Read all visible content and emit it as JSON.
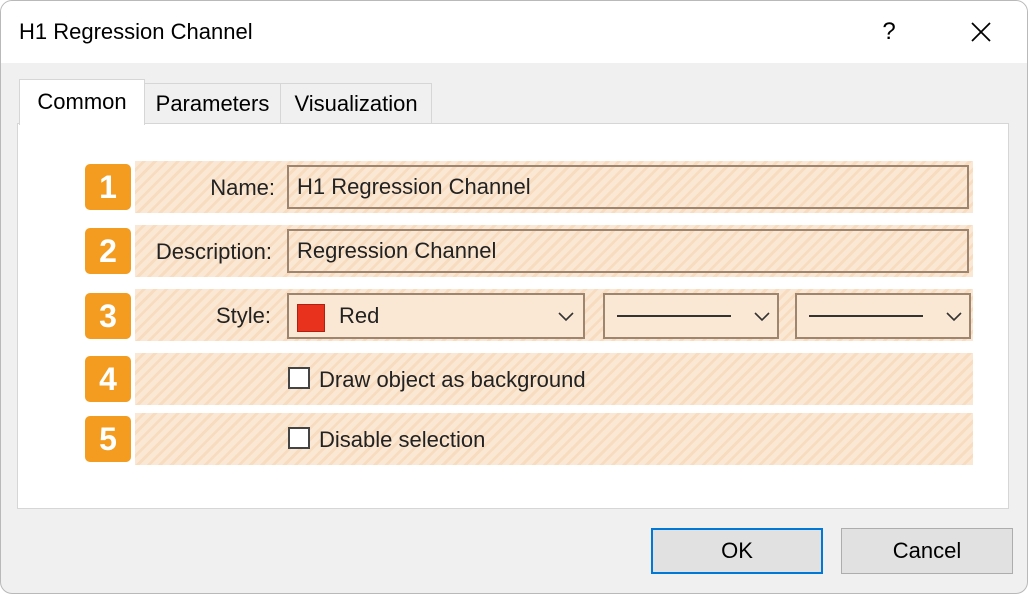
{
  "window": {
    "title": "H1 Regression Channel",
    "help_label": "?"
  },
  "tabs": [
    {
      "label": "Common",
      "active": true
    },
    {
      "label": "Parameters",
      "active": false
    },
    {
      "label": "Visualization",
      "active": false
    }
  ],
  "rows": [
    {
      "number": "1",
      "label": "Name:",
      "value": "H1 Regression Channel"
    },
    {
      "number": "2",
      "label": "Description:",
      "value": "Regression Channel"
    },
    {
      "number": "3",
      "label": "Style:",
      "color_name": "Red",
      "color_hex": "#e8321e"
    },
    {
      "number": "4",
      "checkbox_label": "Draw object as background",
      "checked": false
    },
    {
      "number": "5",
      "checkbox_label": "Disable selection",
      "checked": false
    }
  ],
  "buttons": {
    "ok": "OK",
    "cancel": "Cancel"
  },
  "colors": {
    "badge": "#f39c1f",
    "highlight": "#fbe8d4",
    "focus": "#0078d7"
  }
}
